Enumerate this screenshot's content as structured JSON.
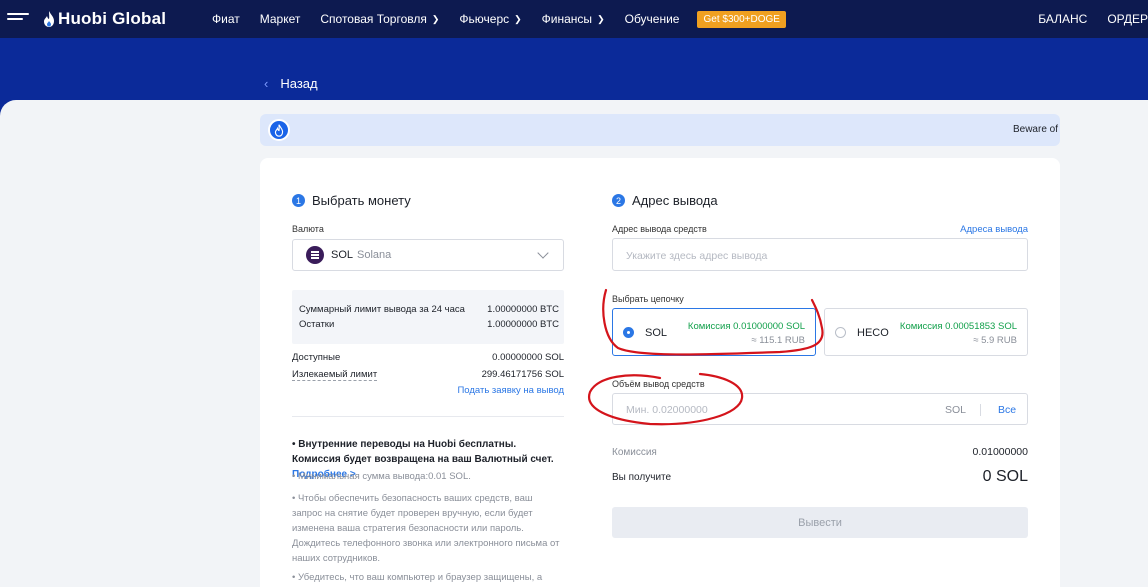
{
  "nav": {
    "logo": "Huobi Global",
    "items": [
      {
        "label": "Фиат",
        "dropdown": false
      },
      {
        "label": "Маркет",
        "dropdown": false
      },
      {
        "label": "Спотовая Торговля",
        "dropdown": true
      },
      {
        "label": "Фьючерс",
        "dropdown": true
      },
      {
        "label": "Финансы",
        "dropdown": true
      },
      {
        "label": "Обучение",
        "dropdown": false
      }
    ],
    "promo": "Get $300+DOGE",
    "right": [
      "БАЛАНС",
      "ОРДЕР"
    ]
  },
  "back_label": "Назад",
  "notice": "Beware of",
  "left": {
    "step_num": "1",
    "step_title": "Выбрать монету",
    "currency_label": "Валюта",
    "coin_code": "SOL",
    "coin_name": "Solana",
    "limit_label": "Суммарный лимит вывода за 24 часа",
    "limit_value": "1.00000000 BTC",
    "remaining_label": "Остатки",
    "remaining_value": "1.00000000 BTC",
    "available_label": "Доступные",
    "available_value": "0.00000000 SOL",
    "withdrawable_label": "Излекаемый лимит",
    "withdrawable_value": "299.46171756 SOL",
    "apply_link": "Подать заявку на вывод",
    "info_bold": "• Внутренние переводы на Huobi бесплатны. Комиссия будет возвращена на ваш Валютный счет.",
    "info_more": "Подробнее >",
    "info_min": "• Минимальная сумма вывода:0.01 SOL.",
    "info_security": "• Чтобы обеспечить безопасность ваших средств, ваш запрос на снятие будет проверен вручную, если будет изменена ваша стратегия безопасности или пароль. Дождитесь телефонного звонка или электронного письма от наших сотрудников.",
    "info_device": "• Убедитесь, что ваш компьютер и браузер защищены, а"
  },
  "right": {
    "step_num": "2",
    "step_title": "Адрес вывода",
    "address_label": "Адрес вывода средств",
    "address_link": "Адреса вывода",
    "address_placeholder": "Укажите здесь адрес вывода",
    "chain_label": "Выбрать цепочку",
    "chains": [
      {
        "name": "SOL",
        "fee": "Комиссия 0.01000000 SOL",
        "rub": "≈ 115.1 RUB",
        "selected": true
      },
      {
        "name": "HECO",
        "fee": "Комиссия 0.00051853 SOL",
        "rub": "≈ 5.9 RUB",
        "selected": false
      }
    ],
    "amount_label": "Объём вывод средств",
    "amount_placeholder": "Мин. 0.02000000",
    "amount_unit": "SOL",
    "all_link": "Все",
    "fee_label": "Комиссия",
    "fee_value": "0.01000000",
    "receive_label": "Вы получите",
    "receive_value": "0 SOL",
    "submit": "Вывести"
  },
  "colors": {
    "nav_bg": "#0d1a50",
    "band_bg": "#0b2a99",
    "accent": "#2b77e5",
    "fee_green": "#12a04b",
    "annotation_red": "#d4141b"
  }
}
